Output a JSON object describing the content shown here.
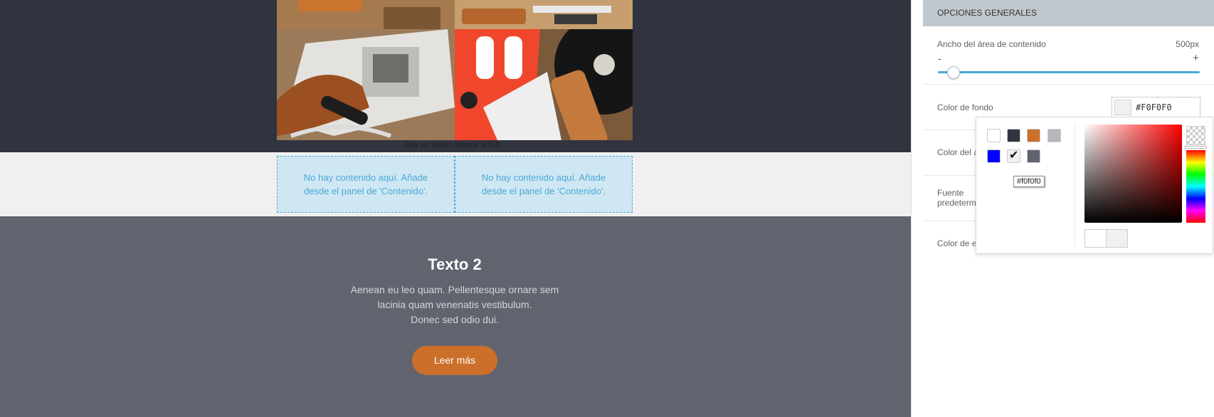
{
  "canvas": {
    "html_block_text": "Soy un nuevo bloque HTML.",
    "empty_columns": [
      {
        "line1": "No hay contenido aquí. Añade",
        "line2": "desde el panel de 'Contenido'."
      },
      {
        "line1": "No hay contenido aquí. Añade",
        "line2": "desde el panel de 'Contenido'."
      }
    ],
    "text_block": {
      "title": "Texto 2",
      "lines": [
        "Aenean eu leo quam. Pellentesque ornare sem",
        "lacinia quam venenatis vestibulum.",
        "Donec sed odio dui."
      ],
      "button_label": "Leer más"
    },
    "colors": {
      "dark_section": "#31333f",
      "light_section": "#f0f0f0",
      "gray_section": "#61636f",
      "button": "#cb6f2a"
    }
  },
  "panel": {
    "header": "OPCIONES GENERALES",
    "content_width": {
      "label": "Ancho del área de contenido",
      "value": "500px",
      "minus": "-",
      "plus": "+",
      "level": 0.06
    },
    "background_color": {
      "label": "Color de fondo",
      "hex": "#F0F0F0"
    },
    "content_color": {
      "label": "Color del á"
    },
    "default_font": {
      "label_line1": "Fuente",
      "label_line2": "predeterm"
    },
    "border_color": {
      "label": "Color de e"
    }
  },
  "color_picker": {
    "presets": [
      "#ffffff",
      "#31333f",
      "#cb6f2a",
      "#b8b6bd",
      "#0000ff",
      "#f0f0f0",
      "#61636f"
    ],
    "selected": "#f0f0f0",
    "tooltip": "#f0f0f0",
    "check_icon": "check-icon",
    "check_glyph": "✔"
  }
}
